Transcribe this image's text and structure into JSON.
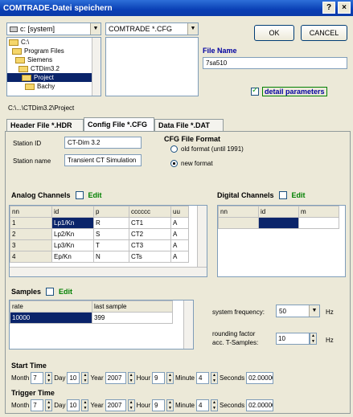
{
  "window": {
    "title": "COMTRADE-Datei speichern",
    "help_glyph": "?",
    "close_glyph": "×"
  },
  "drive_combo": {
    "value": "c: [system]"
  },
  "filter_combo": {
    "value": "COMTRADE *.CFG"
  },
  "folders": [
    "C:\\",
    "Program Files",
    "Siemens",
    "CTDim3.2",
    "Project",
    "Bachy"
  ],
  "current_path": "C:\\...\\CTDim3.2\\Project",
  "ok_button": "OK",
  "cancel_button": "CANCEL",
  "file_name": {
    "label": "File Name",
    "value": "7sa510"
  },
  "detail_parameters": {
    "label": "detail parameters",
    "checked": true
  },
  "tabs": [
    "Header File *.HDR",
    "Config File *.CFG",
    "Data File *.DAT"
  ],
  "station": {
    "id_label": "Station ID",
    "id_value": "CT-Dim 3.2",
    "name_label": "Station name",
    "name_value": "Transient CT Simulation"
  },
  "cfg_format": {
    "title": "CFG File Format",
    "old_label": "old format (until 1991)",
    "new_label": "new format",
    "selected": "new"
  },
  "analog": {
    "title": "Analog Channels",
    "edit_label": "Edit",
    "headers": [
      "nn",
      "id",
      "p",
      "cccccc",
      "uu"
    ],
    "rows": [
      [
        "1",
        "Lp1/Kn",
        "R",
        "CT1",
        "A"
      ],
      [
        "2",
        "Lp2/Kn",
        "S",
        "CT2",
        "A"
      ],
      [
        "3",
        "Lp3/Kn",
        "T",
        "CT3",
        "A"
      ],
      [
        "4",
        "Ep/Kn",
        "N",
        "CTs",
        "A"
      ]
    ]
  },
  "digital": {
    "title": "Digital Channels",
    "edit_label": "Edit",
    "headers": [
      "nn",
      "id",
      "m"
    ]
  },
  "samples": {
    "title": "Samples",
    "edit_label": "Edit",
    "headers": [
      "rate",
      "last sample"
    ],
    "rows": [
      [
        "10000",
        "399"
      ]
    ]
  },
  "system_frequency": {
    "label": "system frequency:",
    "value": "50",
    "unit": "Hz"
  },
  "rounding": {
    "label1": "rounding factor",
    "label2": "acc. T-Samples:",
    "value": "10",
    "unit": "Hz"
  },
  "time_labels": {
    "month": "Month",
    "day": "Day",
    "year": "Year",
    "hour": "Hour",
    "minute": "Minute",
    "seconds": "Seconds"
  },
  "start_time": {
    "title": "Start Time",
    "month": "7",
    "day": "10",
    "year": "2007",
    "hour": "9",
    "minute": "4",
    "seconds": "02.000000"
  },
  "trigger_time": {
    "title": "Trigger Time",
    "month": "7",
    "day": "10",
    "year": "2007",
    "hour": "9",
    "minute": "4",
    "seconds": "02.000000"
  }
}
